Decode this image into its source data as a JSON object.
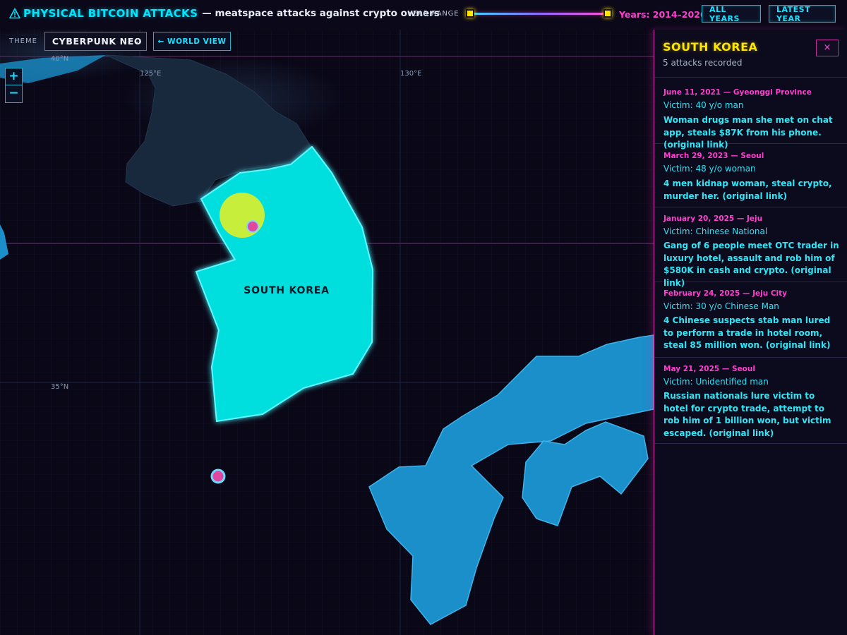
{
  "header": {
    "title": "PHYSICAL BITCOIN ATTACKS",
    "subtitle": "— meatspace attacks against crypto owners",
    "year_range_label": "YEAR RANGE",
    "years_readout": "Years: 2014–2026",
    "year_range_selected": [
      2014,
      2026
    ],
    "all_years_button": "ALL YEARS",
    "latest_year_button": "LATEST YEAR",
    "icon": "warning-icon"
  },
  "controls": {
    "theme_label": "THEME",
    "theme_value": "CYBERPUNK NEO",
    "world_view_button": "← WORLD VIEW",
    "zoom_in": "+",
    "zoom_out": "−"
  },
  "map": {
    "grid_labels": {
      "lat_40": "40°N",
      "lat_35": "35°N",
      "lon_125": "125°E",
      "lon_130": "130°E"
    },
    "selected_country_label": "SOUTH KOREA",
    "colors": {
      "selected_country": "#00dede",
      "other_land": "#1a8fc9",
      "north_korea": "#18283d",
      "hotspot": "#d9ef2e",
      "marker": "#e0479f",
      "background": "#0a0716"
    }
  },
  "panel": {
    "title": "SOUTH KOREA",
    "count": "5 attacks recorded",
    "close": "×",
    "attacks": [
      {
        "meta": "June 11, 2021 — Gyeonggi Province",
        "victim": "Victim: 40 y/o man",
        "description": "Woman drugs man she met on chat app, steals $87K from his phone. (original link)"
      },
      {
        "meta": "March 29, 2023 — Seoul",
        "victim": "Victim: 48 y/o woman",
        "description": "4 men kidnap woman, steal crypto, murder her. (original link)"
      },
      {
        "meta": "January 20, 2025 — Jeju",
        "victim": "Victim: Chinese National",
        "description": "Gang of 6 people meet OTC trader in luxury hotel, assault and rob him of $580K in cash and crypto. (original link)"
      },
      {
        "meta": "February 24, 2025 — Jeju City",
        "victim": "Victim: 30 y/o Chinese Man",
        "description": "4 Chinese suspects stab man lured to perform a trade in hotel room, steal 85 million won. (original link)"
      },
      {
        "meta": "May 21, 2025 — Seoul",
        "victim": "Victim: Unidentified man",
        "description": "Russian nationals lure victim to hotel for crypto trade, attempt to rob him of 1 billion won, but victim escaped. (original link)"
      }
    ]
  }
}
